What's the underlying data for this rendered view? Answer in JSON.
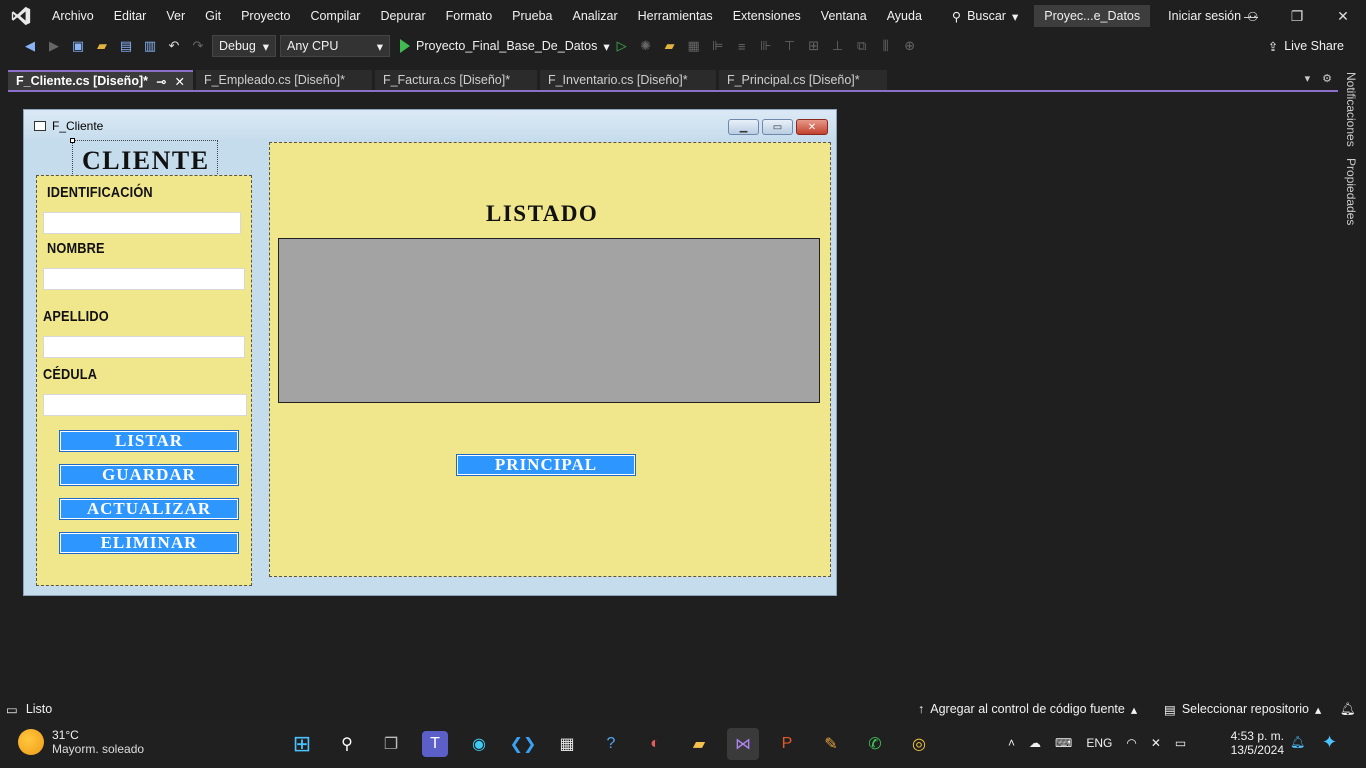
{
  "menu": [
    "Archivo",
    "Editar",
    "Ver",
    "Git",
    "Proyecto",
    "Compilar",
    "Depurar",
    "Formato",
    "Prueba",
    "Analizar",
    "Herramientas",
    "Extensiones",
    "Ventana",
    "Ayuda"
  ],
  "search_label": "Buscar",
  "solution_name": "Proyec...e_Datos",
  "signin": "Iniciar sesión",
  "toolbar": {
    "config": "Debug",
    "platform": "Any CPU",
    "run_target": "Proyecto_Final_Base_De_Datos",
    "live_share": "Live Share"
  },
  "tabs": [
    {
      "label": "F_Cliente.cs [Diseño]*",
      "active": true
    },
    {
      "label": "F_Empleado.cs [Diseño]*"
    },
    {
      "label": "F_Factura.cs [Diseño]*"
    },
    {
      "label": "F_Inventario.cs [Diseño]*"
    },
    {
      "label": "F_Principal.cs [Diseño]*"
    }
  ],
  "side_panel": {
    "notifications": "Notificaciones",
    "properties": "Propiedades"
  },
  "form": {
    "title": "F_Cliente",
    "heading": "CLIENTE",
    "labels": {
      "id": "IDENTIFICACIÓN",
      "nombre": "NOMBRE",
      "apellido": "APELLIDO",
      "cedula": "CÉDULA"
    },
    "buttons": {
      "listar": "LISTAR",
      "guardar": "GUARDAR",
      "actualizar": "ACTUALIZAR",
      "eliminar": "ELIMINAR",
      "principal": "PRINCIPAL"
    },
    "list_heading": "LISTADO"
  },
  "status": {
    "left": "Listo",
    "source_control": "Agregar al control de código fuente",
    "repo": "Seleccionar repositorio"
  },
  "taskbar": {
    "weather_temp": "31°C",
    "weather_desc": "Mayorm. soleado",
    "lang": "ENG",
    "time": "4:53 p. m.",
    "date": "13/5/2024"
  }
}
